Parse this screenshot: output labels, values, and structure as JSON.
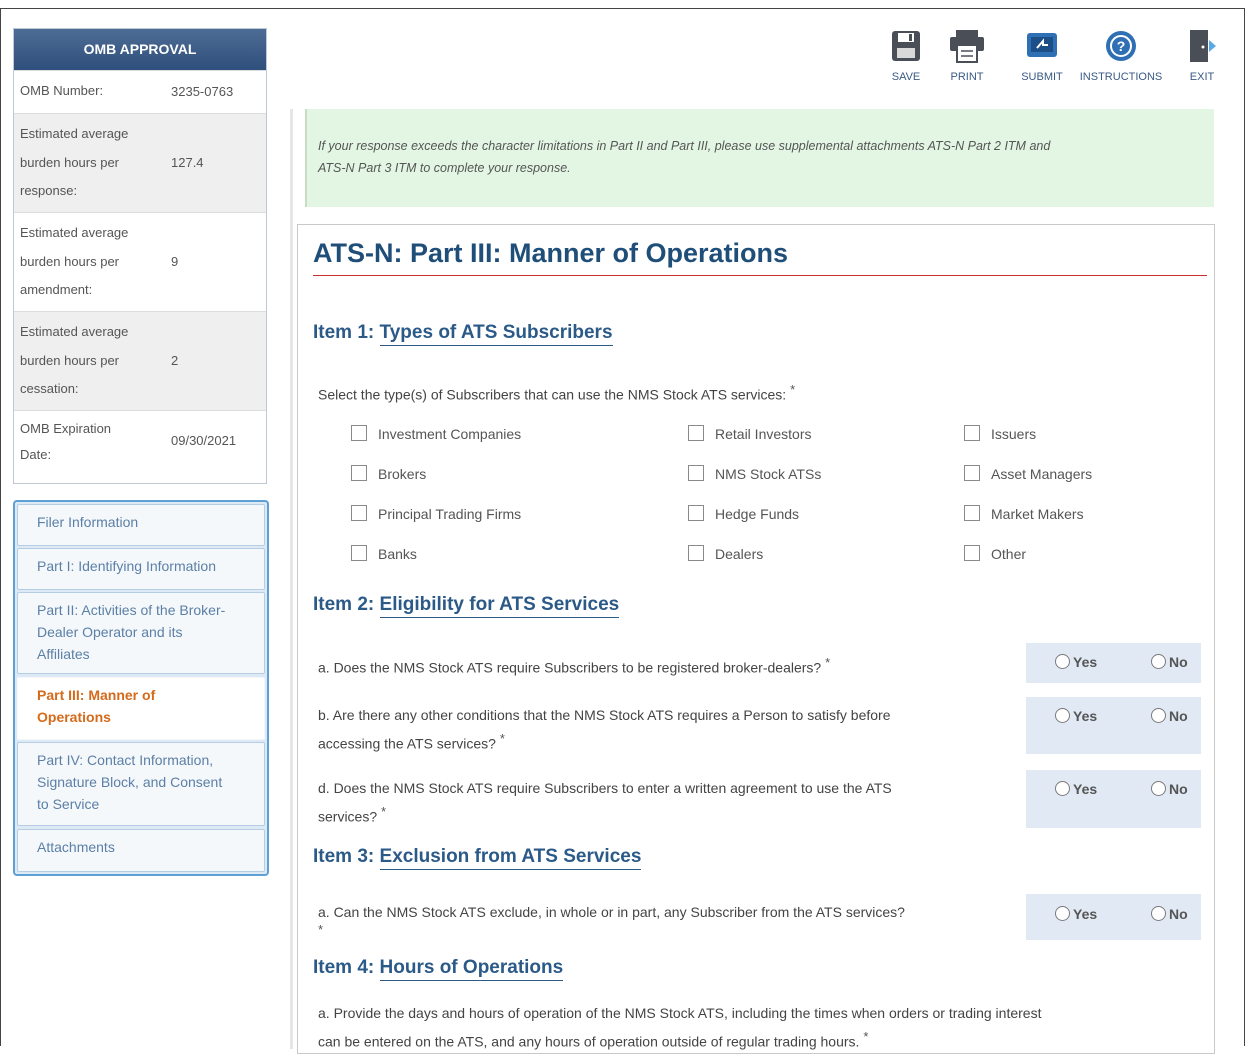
{
  "omb": {
    "header": "OMB APPROVAL",
    "rows": [
      {
        "label": "OMB Number:",
        "value": "3235-0763"
      },
      {
        "label": "Estimated average burden hours per response:",
        "l1": "Estimated average",
        "l2": "burden hours per",
        "l3": "response:",
        "value": "127.4"
      },
      {
        "label": "Estimated average burden hours per amendment:",
        "l1": "Estimated average",
        "l2": "burden hours per",
        "l3": "amendment:",
        "value": "9"
      },
      {
        "label": "Estimated average burden hours per cessation:",
        "l1": "Estimated average",
        "l2": "burden hours per",
        "l3": "cessation:",
        "value": "2"
      },
      {
        "label": "OMB Expiration Date:",
        "l1": "OMB Expiration",
        "l2": "Date:",
        "value": "09/30/2021"
      }
    ]
  },
  "nav": {
    "items": [
      {
        "label": "Filer Information"
      },
      {
        "label": "Part I: Identifying Information"
      },
      {
        "label": "Part II: Activities of the Broker-Dealer Operator and its Affiliates",
        "l1": "Part II: Activities of the Broker-",
        "l2": "Dealer Operator and its",
        "l3": "Affiliates"
      },
      {
        "label": "Part III: Manner of Operations",
        "l1": "Part III: Manner of",
        "l2": "Operations",
        "active": true
      },
      {
        "label": "Part IV: Contact Information, Signature Block, and Consent to Service",
        "l1": "Part IV: Contact Information,",
        "l2": "Signature Block, and Consent",
        "l3": "to Service"
      },
      {
        "label": "Attachments"
      }
    ]
  },
  "toolbar": {
    "save": "SAVE",
    "print": "PRINT",
    "submit": "SUBMIT",
    "instructions": "INSTRUCTIONS",
    "exit": "EXIT",
    "colors": {
      "icon_dark": "#4a4f57",
      "icon_blue": "#2f6fb3"
    }
  },
  "notice": {
    "line1": "If your response exceeds the character limitations in Part II and Part III, please use supplemental attachments ATS-N Part 2 ITM and",
    "line2": "ATS-N Part 3 ITM to complete your response."
  },
  "page_title": "ATS-N: Part III: Manner of Operations",
  "item1": {
    "prefix": "Item 1:",
    "title": "Types of ATS Subscribers",
    "question": "Select the type(s) of Subscribers that can use the NMS Stock ATS services:",
    "required_mark": "*",
    "options": [
      "Investment Companies",
      "Retail Investors",
      "Issuers",
      "Brokers",
      "NMS Stock ATSs",
      "Asset Managers",
      "Principal Trading Firms",
      "Hedge Funds",
      "Market Makers",
      "Banks",
      "Dealers",
      "Other"
    ]
  },
  "item2": {
    "prefix": "Item 2:",
    "title": "Eligibility for ATS Services",
    "questions": [
      {
        "l1": "a. Does the NMS Stock ATS require Subscribers to be registered broker-dealers?",
        "l2": ""
      },
      {
        "l1": "b. Are there any other conditions that the NMS Stock ATS requires a Person to satisfy before",
        "l2": "accessing the ATS services?"
      },
      {
        "l1": "d. Does the NMS Stock ATS require Subscribers to enter a written agreement to use the ATS",
        "l2": "services?"
      }
    ]
  },
  "item3": {
    "prefix": "Item 3:",
    "title": "Exclusion from ATS Services",
    "question": "a. Can the NMS Stock ATS exclude, in whole or in part, any Subscriber from the ATS services?"
  },
  "item4": {
    "prefix": "Item 4:",
    "title": "Hours of Operations",
    "l1": "a. Provide the days and hours of operation of the NMS Stock ATS, including the times when orders or trading interest",
    "l2": "can be entered on the ATS, and any hours of operation outside of regular trading hours."
  },
  "answers": {
    "yes": "Yes",
    "no": "No"
  }
}
